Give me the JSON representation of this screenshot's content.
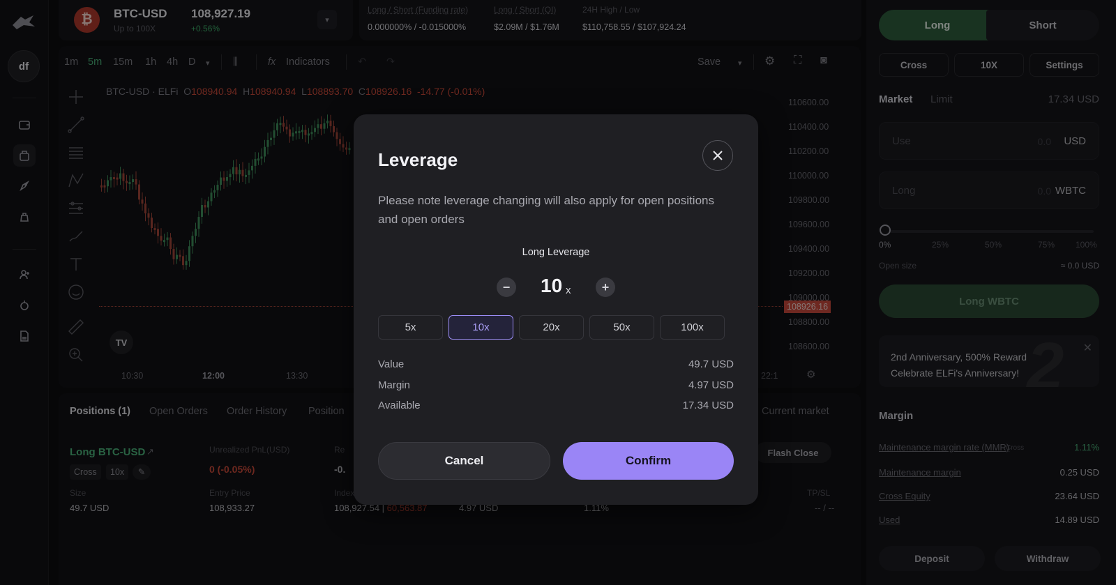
{
  "header": {
    "pair": "BTC-USD",
    "pair_sub": "Up to 100X",
    "btc_symbol": "₿",
    "price": "108,927.19",
    "change": "+0.56%",
    "stats": [
      {
        "label": "Long / Short (Funding rate)",
        "value": "0.000000% / -0.015000%"
      },
      {
        "label": "Long / Short (OI)",
        "value": "$2.09M / $1.76M"
      },
      {
        "label": "24H High / Low",
        "value": "$110,758.55 / $107,924.24"
      }
    ]
  },
  "nav": {
    "avatar_initials": "df"
  },
  "chart": {
    "timeframes": [
      "1m",
      "5m",
      "15m",
      "1h",
      "4h",
      "D"
    ],
    "active_timeframe": "5m",
    "indicators_label": "Indicators",
    "save_label": "Save",
    "legend": {
      "title": "BTC-USD · ELFi",
      "o": "108940.94",
      "h": "108940.94",
      "l": "108893.70",
      "c": "108926.16",
      "chg": "-14.77 (-0.01%)"
    },
    "y_ticks": [
      "110600.00",
      "110400.00",
      "110200.00",
      "110000.00",
      "109800.00",
      "109600.00",
      "109400.00",
      "109200.00",
      "109000.00",
      "108800.00",
      "108600.00"
    ],
    "current_price_tag": "108926.16",
    "x_ticks": [
      "10:30",
      "12:00",
      "13:30",
      "22:1"
    ],
    "tv_logo": "TV"
  },
  "bottom": {
    "tabs": [
      "Positions (1)",
      "Open Orders",
      "Order History",
      "Position"
    ],
    "current_market_label": "Current market",
    "position": {
      "title": "Long BTC-USD",
      "chips": [
        "Cross",
        "10x"
      ],
      "upnl_label": "Unrealized PnL(USD)",
      "upnl_value": "0 (-0.05%)",
      "re_label": "Re",
      "re_value": "-0.",
      "size_label": "Size",
      "size_value": "49.7 USD",
      "entry_label": "Entry Price",
      "entry_value": "108,933.27",
      "index_label": "Index",
      "index_value": "108,927.54 | ",
      "liq_value": "60,563.87",
      "margin_value": "4.97 USD",
      "mmr_value": "1.11%",
      "tpsl_label": "TP/SL",
      "tpsl_value": "-- / --",
      "flash_close": "Flash Close"
    }
  },
  "right": {
    "long_tab": "Long",
    "short_tab": "Short",
    "btns": [
      "Cross",
      "10X",
      "Settings"
    ],
    "market": "Market",
    "limit": "Limit",
    "balance": "17.34 USD",
    "use_placeholder": "Use",
    "use_value": "0.0",
    "use_unit": "USD",
    "long_placeholder": "Long",
    "long_value": "0.0",
    "long_unit": "WBTC",
    "slider_marks": [
      "0%",
      "25%",
      "50%",
      "75%",
      "100%"
    ],
    "slider_value_pct": 0,
    "open_size_label": "Open size",
    "open_size_value": "≈ 0.0 USD",
    "submit": "Long WBTC",
    "promo_line1": "2nd Anniversary, 500% Reward",
    "promo_line2": "Celebrate ELFi's Anniversary!",
    "promo_big": "2",
    "margin_title": "Margin",
    "margin_rows": [
      {
        "label": "Maintenance margin rate (MMR)",
        "tag": "Cross",
        "value": "1.11%"
      },
      {
        "label": "Maintenance margin",
        "value": "0.25 USD"
      },
      {
        "label": "Cross Equity",
        "value": "23.64 USD"
      },
      {
        "label": "Used",
        "value": "14.89 USD"
      }
    ],
    "deposit": "Deposit",
    "withdraw": "Withdraw"
  },
  "modal": {
    "title": "Leverage",
    "note": "Please note leverage changing will also apply for open positions and open orders",
    "subtitle": "Long Leverage",
    "value": "10",
    "unit": "x",
    "options": [
      "5x",
      "10x",
      "20x",
      "50x",
      "100x"
    ],
    "selected": "10x",
    "rows": [
      {
        "label": "Value",
        "value": "49.7 USD"
      },
      {
        "label": "Margin",
        "value": "4.97 USD"
      },
      {
        "label": "Available",
        "value": "17.34 USD"
      }
    ],
    "cancel": "Cancel",
    "confirm": "Confirm"
  },
  "colors": {
    "accent_green": "#4cb27a",
    "accent_red": "#c9493a",
    "accent_purple": "#9a85f6"
  }
}
